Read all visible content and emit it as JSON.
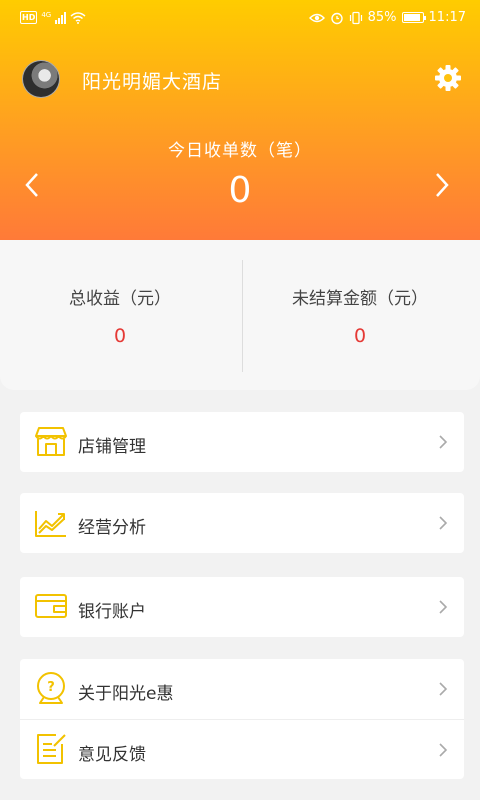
{
  "status_bar": {
    "left_badge": "HD",
    "network": "4G",
    "battery_percent": "85%",
    "time": "11:17"
  },
  "header": {
    "hotel_name": "阳光明媚大酒店",
    "orders_label": "今日收单数（笔）",
    "orders_value": "0"
  },
  "stats": {
    "total_income_label": "总收益（元）",
    "total_income_value": "0",
    "unsettled_label": "未结算金额（元）",
    "unsettled_value": "0"
  },
  "menu": {
    "store": "店铺管理",
    "analysis": "经营分析",
    "bank": "银行账户",
    "about": "关于阳光e惠",
    "feedback": "意见反馈"
  },
  "colors": {
    "accent_yellow": "#f2c200",
    "value_red": "#e53935",
    "header_top": "#ffcc00",
    "header_bottom": "#ff7a38"
  },
  "icons": {
    "settings": "gear-icon",
    "prev": "chevron-left-icon",
    "next": "chevron-right-icon",
    "store": "storefront-icon",
    "analysis": "trend-chart-icon",
    "bank": "wallet-card-icon",
    "about": "question-bubble-icon",
    "feedback": "edit-note-icon"
  }
}
